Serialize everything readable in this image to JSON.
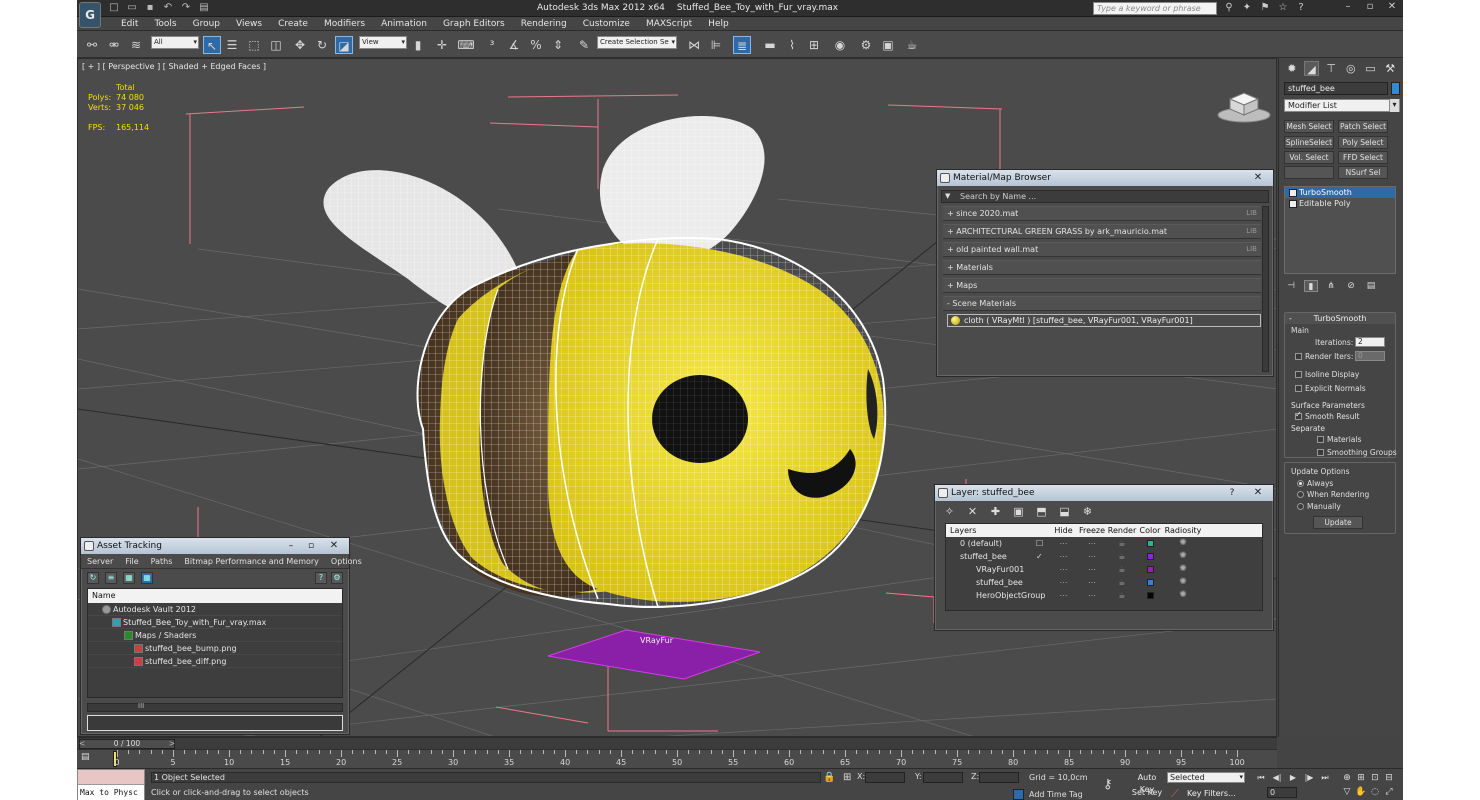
{
  "app": {
    "title_app": "Autodesk 3ds Max  2012 x64",
    "title_file": "Stuffed_Bee_Toy_with_Fur_vray.max",
    "logo": "G",
    "search_placeholder": "Type a keyword or phrase"
  },
  "menu": [
    "Edit",
    "Tools",
    "Group",
    "Views",
    "Create",
    "Modifiers",
    "Animation",
    "Graph Editors",
    "Rendering",
    "Customize",
    "MAXScript",
    "Help"
  ],
  "toolbar": {
    "filter_value": "All",
    "refcoord_value": "View",
    "selection_set_placeholder": "Create Selection Se"
  },
  "viewport": {
    "label": "[ + ] [ Perspective ] [ Shaded + Edged Faces ]",
    "stats_total": "Total",
    "polys_label": "Polys:",
    "polys_value": "74 080",
    "verts_label": "Verts:",
    "verts_value": "37 046",
    "fps_label": "FPS:",
    "fps_value": "165,114",
    "fur_label": "VRayFur"
  },
  "material_browser": {
    "title": "Material/Map Browser",
    "search": "Search by Name ...",
    "rows": [
      {
        "label": "+ since 2020.mat",
        "tag": "LIB"
      },
      {
        "label": "+ ARCHITECTURAL GREEN GRASS by ark_mauricio.mat",
        "tag": "LIB"
      },
      {
        "label": "+ old painted wall.mat",
        "tag": "LIB"
      },
      {
        "label": "+ Materials",
        "tag": ""
      },
      {
        "label": "+ Maps",
        "tag": ""
      },
      {
        "label": "- Scene Materials",
        "tag": ""
      }
    ],
    "scene_material": "cloth  ( VRayMtl )  [stuffed_bee, VRayFur001, VRayFur001]"
  },
  "layer_manager": {
    "title": "Layer: stuffed_bee",
    "help": "?",
    "columns": [
      "Layers",
      "Hide",
      "Freeze",
      "Render",
      "Color",
      "Radiosity"
    ],
    "rows": [
      {
        "name": "0 (default)",
        "color": "#2fb28f",
        "active": "☐"
      },
      {
        "name": "stuffed_bee",
        "color": "#8a2bc8",
        "active": "✓"
      },
      {
        "name": "VRayFur001",
        "color": "#9a1fb8",
        "active": ""
      },
      {
        "name": "stuffed_bee",
        "color": "#3a7fd8",
        "active": ""
      },
      {
        "name": "HeroObjectGroup",
        "color": "#050505",
        "active": ""
      }
    ]
  },
  "asset_tracking": {
    "title": "Asset Tracking",
    "menu": [
      "Server",
      "File",
      "Paths",
      "Bitmap Performance and Memory",
      "Options"
    ],
    "column": "Name",
    "rows": [
      {
        "label": "Autodesk Vault 2012",
        "indent": 1
      },
      {
        "label": "Stuffed_Bee_Toy_with_Fur_vray.max",
        "indent": 2
      },
      {
        "label": "Maps / Shaders",
        "indent": 3
      },
      {
        "label": "stuffed_bee_bump.png",
        "indent": 4
      },
      {
        "label": "stuffed_bee_diff.png",
        "indent": 4
      }
    ],
    "scroll_mark": "III"
  },
  "command_panel": {
    "object_name": "stuffed_bee",
    "modifier_list": "Modifier List",
    "buttons": [
      "Mesh Select",
      "Patch Select",
      "SplineSelect",
      "Poly Select",
      "Vol. Select",
      "FFD Select",
      "",
      "NSurf Sel"
    ],
    "stack": [
      "TurboSmooth",
      "Editable Poly"
    ],
    "rollout_title": "TurboSmooth",
    "main_label": "Main",
    "iterations_label": "Iterations:",
    "iterations_value": "2",
    "render_iters_label": "Render Iters:",
    "render_iters_value": "0",
    "isoline": "Isoline Display",
    "explicit": "Explicit Normals",
    "surface_params": "Surface Parameters",
    "smooth_result": "Smooth Result",
    "separate": "Separate",
    "materials": "Materials",
    "smoothing_groups": "Smoothing Groups",
    "update_options": "Update Options",
    "always": "Always",
    "when_rendering": "When Rendering",
    "manually": "Manually",
    "update_button": "Update"
  },
  "timeline": {
    "slider": "0 / 100",
    "ticks": [
      "0",
      "5",
      "10",
      "15",
      "20",
      "25",
      "30",
      "35",
      "40",
      "45",
      "50",
      "55",
      "60",
      "65",
      "70",
      "75",
      "80",
      "85",
      "90",
      "95",
      "100"
    ]
  },
  "status": {
    "maxscript": "Max to Physc",
    "selected": "1 Object Selected",
    "prompt": "Click or click-and-drag to select objects",
    "x": "X:",
    "y": "Y:",
    "z": "Z:",
    "grid": "Grid = 10,0cm",
    "add_time_tag": "Add Time Tag",
    "auto_key": "Auto Key",
    "set_key": "Set Key",
    "key_mode": "Selected",
    "key_filters": "Key Filters...",
    "frame": "0"
  },
  "colors": {
    "accent": "#2f6aa8",
    "viewport_bg": "#4b4b4b",
    "stats": "#f1e000",
    "bee_yellow": "#f2e02a",
    "fur_plane": "#8a1fa8"
  }
}
